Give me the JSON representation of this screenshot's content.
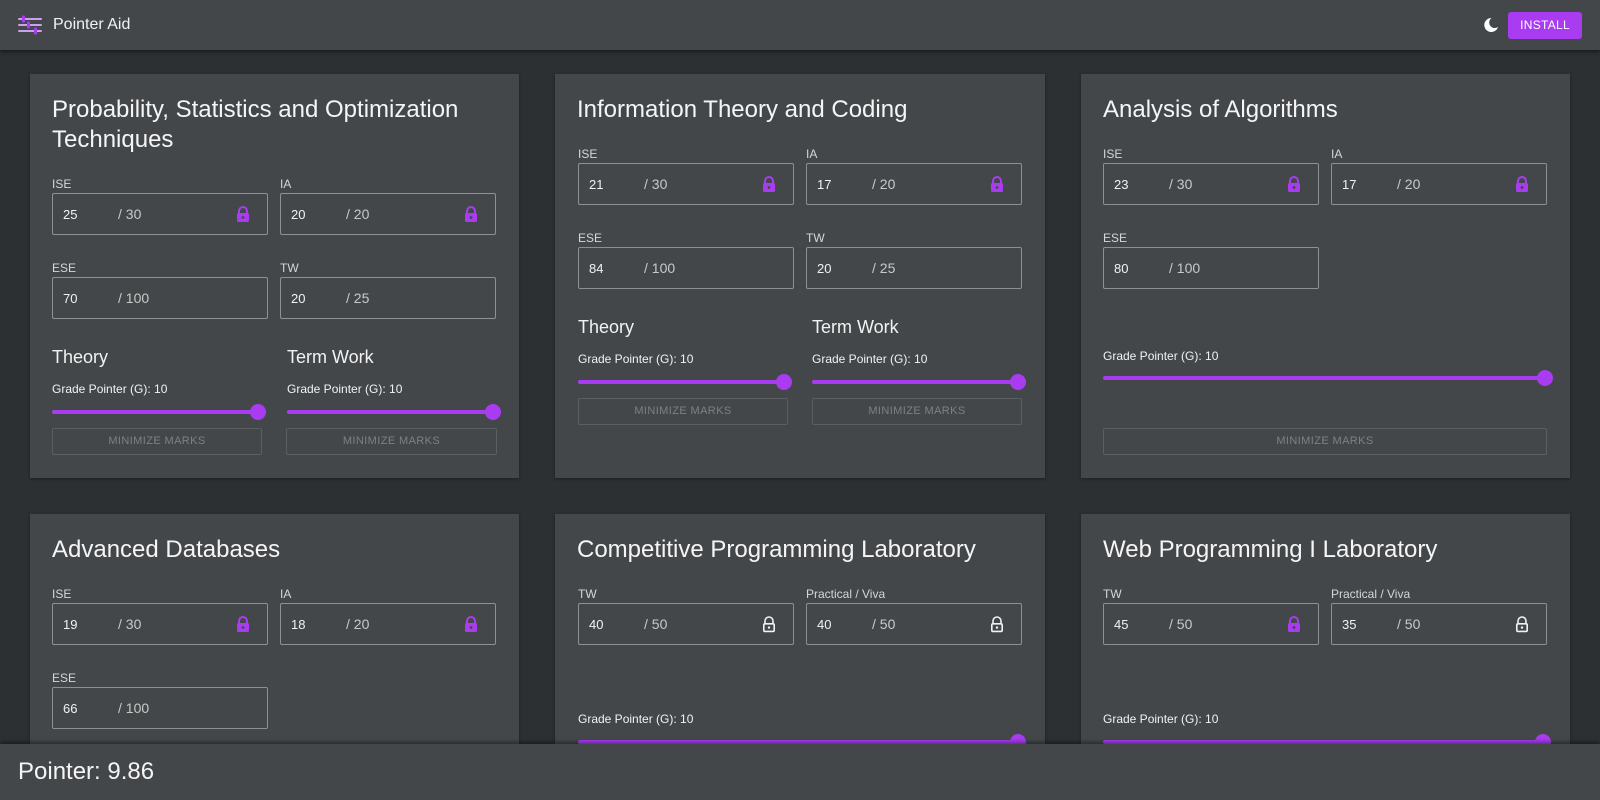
{
  "app": {
    "title": "Pointer Aid",
    "install_label": "INSTALL",
    "accent": "#a93cf0"
  },
  "icons": {
    "menu": "tune-sliders-icon",
    "theme": "moon-icon",
    "lock_closed": "lock-icon",
    "lock_open": "lock-open-icon"
  },
  "subjects": [
    {
      "title": "Probability, Statistics and Optimization Techniques",
      "fields": [
        {
          "label": "ISE",
          "value": "25",
          "max": "/ 30",
          "lock": "closed"
        },
        {
          "label": "IA",
          "value": "20",
          "max": "/ 20",
          "lock": "closed"
        },
        {
          "label": "ESE",
          "value": "70",
          "max": "/ 100",
          "lock": "none"
        },
        {
          "label": "TW",
          "value": "20",
          "max": "/ 25",
          "lock": "none"
        }
      ],
      "sections": [
        {
          "title": "Theory",
          "grade_label": "Grade Pointer (G): 10",
          "grade": 10,
          "minimize_label": "MINIMIZE MARKS"
        },
        {
          "title": "Term Work",
          "grade_label": "Grade Pointer (G): 10",
          "grade": 10,
          "minimize_label": "MINIMIZE MARKS"
        }
      ]
    },
    {
      "title": "Information Theory and Coding",
      "fields": [
        {
          "label": "ISE",
          "value": "21",
          "max": "/ 30",
          "lock": "closed"
        },
        {
          "label": "IA",
          "value": "17",
          "max": "/ 20",
          "lock": "closed"
        },
        {
          "label": "ESE",
          "value": "84",
          "max": "/ 100",
          "lock": "none"
        },
        {
          "label": "TW",
          "value": "20",
          "max": "/ 25",
          "lock": "none"
        }
      ],
      "sections": [
        {
          "title": "Theory",
          "grade_label": "Grade Pointer (G): 10",
          "grade": 10,
          "minimize_label": "MINIMIZE MARKS"
        },
        {
          "title": "Term Work",
          "grade_label": "Grade Pointer (G): 10",
          "grade": 10,
          "minimize_label": "MINIMIZE MARKS"
        }
      ]
    },
    {
      "title": "Analysis of Algorithms",
      "fields": [
        {
          "label": "ISE",
          "value": "23",
          "max": "/ 30",
          "lock": "closed"
        },
        {
          "label": "IA",
          "value": "17",
          "max": "/ 20",
          "lock": "closed"
        },
        {
          "label": "ESE",
          "value": "80",
          "max": "/ 100",
          "lock": "none"
        }
      ],
      "sections": [
        {
          "grade_label": "Grade Pointer (G): 10",
          "grade": 10,
          "minimize_label": "MINIMIZE MARKS"
        }
      ]
    },
    {
      "title": "Advanced Databases",
      "fields": [
        {
          "label": "ISE",
          "value": "19",
          "max": "/ 30",
          "lock": "closed"
        },
        {
          "label": "IA",
          "value": "18",
          "max": "/ 20",
          "lock": "closed"
        },
        {
          "label": "ESE",
          "value": "66",
          "max": "/ 100",
          "lock": "none"
        }
      ]
    },
    {
      "title": "Competitive Programming Laboratory",
      "fields": [
        {
          "label": "TW",
          "value": "40",
          "max": "/ 50",
          "lock": "open"
        },
        {
          "label": "Practical / Viva",
          "value": "40",
          "max": "/ 50",
          "lock": "open"
        }
      ],
      "sections": [
        {
          "grade_label": "Grade Pointer (G): 10",
          "grade": 10
        }
      ]
    },
    {
      "title": "Web Programming I Laboratory",
      "fields": [
        {
          "label": "TW",
          "value": "45",
          "max": "/ 50",
          "lock": "closed"
        },
        {
          "label": "Practical / Viva",
          "value": "35",
          "max": "/ 50",
          "lock": "open"
        }
      ],
      "sections": [
        {
          "grade_label": "Grade Pointer (G): 10",
          "grade": 10
        }
      ]
    }
  ],
  "footer": {
    "pointer_text": "Pointer: 9.86"
  }
}
